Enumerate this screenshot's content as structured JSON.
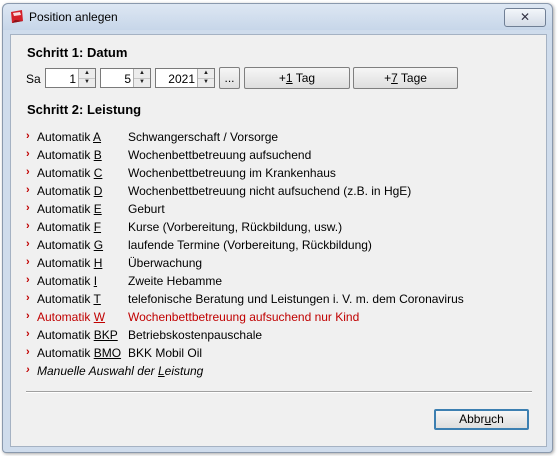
{
  "window": {
    "title": "Position anlegen",
    "close_label": "✕"
  },
  "step1": {
    "heading": "Schritt 1: Datum",
    "weekday": "Sa",
    "day": "1",
    "month": "5",
    "year": "2021",
    "more_button": "...",
    "plus1_prefix": "+",
    "plus1_accel": "1",
    "plus1_suffix": " Tag",
    "plus7_prefix": "+",
    "plus7_accel": "7",
    "plus7_suffix": " Tage"
  },
  "step2": {
    "heading": "Schritt 2: Leistung",
    "items": [
      {
        "auto": "Automatik ",
        "key": "A",
        "desc": "Schwangerschaft / Vorsorge",
        "highlight": false
      },
      {
        "auto": "Automatik ",
        "key": "B",
        "desc": "Wochenbettbetreuung aufsuchend",
        "highlight": false
      },
      {
        "auto": "Automatik ",
        "key": "C",
        "desc": "Wochenbettbetreuung im Krankenhaus",
        "highlight": false
      },
      {
        "auto": "Automatik ",
        "key": "D",
        "desc": "Wochenbettbetreuung nicht aufsuchend (z.B. in HgE)",
        "highlight": false
      },
      {
        "auto": "Automatik ",
        "key": "E",
        "desc": "Geburt",
        "highlight": false
      },
      {
        "auto": "Automatik ",
        "key": "F",
        "desc": "Kurse (Vorbereitung, Rückbildung, usw.)",
        "highlight": false
      },
      {
        "auto": "Automatik ",
        "key": "G",
        "desc": "laufende Termine (Vorbereitung, Rückbildung)",
        "highlight": false
      },
      {
        "auto": "Automatik ",
        "key": "H",
        "desc": "Überwachung",
        "highlight": false
      },
      {
        "auto": "Automatik ",
        "key": "I",
        "desc": "Zweite Hebamme",
        "highlight": false
      },
      {
        "auto": "Automatik ",
        "key": "T",
        "desc": "telefonische Beratung und Leistungen i. V. m. dem Coronavirus",
        "highlight": false
      },
      {
        "auto": "Automatik ",
        "key": "W",
        "desc": "Wochenbettbetreuung aufsuchend nur Kind",
        "highlight": true
      },
      {
        "auto": "Automatik ",
        "key": "BKP",
        "desc": "Betriebskostenpauschale",
        "highlight": false
      },
      {
        "auto": "Automatik ",
        "key": "BMO",
        "desc": "BKK Mobil Oil",
        "highlight": false
      }
    ],
    "manual_prefix": "Manuelle Auswahl der ",
    "manual_accel": "L",
    "manual_suffix": "eistung"
  },
  "footer": {
    "cancel_prefix": "Abbr",
    "cancel_accel": "u",
    "cancel_suffix": "ch"
  },
  "colors": {
    "accent_red": "#c00000",
    "client_bg": "#f0f0f0",
    "frame": "#cfdcec"
  }
}
